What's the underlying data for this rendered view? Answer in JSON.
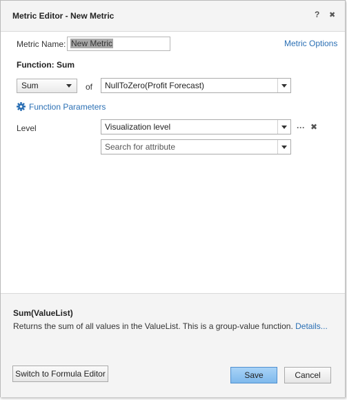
{
  "dialog": {
    "title": "Metric Editor - New Metric",
    "help_label": "?",
    "close_label": "✖"
  },
  "metric": {
    "name_label": "Metric Name:",
    "name_value": "New Metric",
    "options_link": "Metric Options"
  },
  "function": {
    "heading": "Function: Sum",
    "selected": "Sum",
    "of_label": "of",
    "argument": "NullToZero(Profit Forecast)",
    "parameters_link": "Function Parameters"
  },
  "level": {
    "label": "Level",
    "value": "Visualization level",
    "search_placeholder": "Search for attribute",
    "more_label": "···",
    "remove_label": "✖"
  },
  "description": {
    "signature": "Sum(ValueList)",
    "text": "Returns the sum of all values in the ValueList. This is a group-value function. ",
    "details_link": "Details..."
  },
  "buttons": {
    "formula_editor": "Switch to Formula Editor",
    "save": "Save",
    "cancel": "Cancel"
  },
  "colors": {
    "link": "#2a6fb4",
    "save_button": "#8cc2ef",
    "panel_background": "#f4f4f4"
  }
}
